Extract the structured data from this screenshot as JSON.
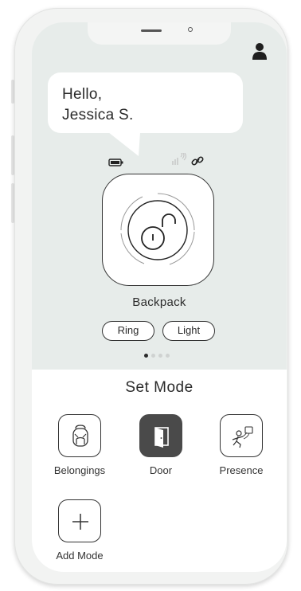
{
  "greeting": {
    "line1": "Hello,",
    "line2": "Jessica S."
  },
  "device": {
    "name": "Backpack",
    "lock_state": "unlocked",
    "status_icons": [
      "battery-icon",
      "signal-icon",
      "link-icon"
    ]
  },
  "actions": [
    {
      "label": "Ring"
    },
    {
      "label": "Light"
    }
  ],
  "pager": {
    "count": 4,
    "active": 1
  },
  "mode_sheet": {
    "title": "Set Mode",
    "modes": [
      {
        "label": "Belongings",
        "icon": "backpack-icon",
        "selected": false
      },
      {
        "label": "Door",
        "icon": "door-icon",
        "selected": true
      },
      {
        "label": "Presence",
        "icon": "presence-icon",
        "selected": false
      },
      {
        "label": "Add Mode",
        "icon": "plus-icon",
        "selected": false
      }
    ]
  },
  "colors": {
    "screen_bg": "#e7ecea",
    "selected_mode": "#4a4a4a",
    "ink": "#2b2b2b"
  }
}
